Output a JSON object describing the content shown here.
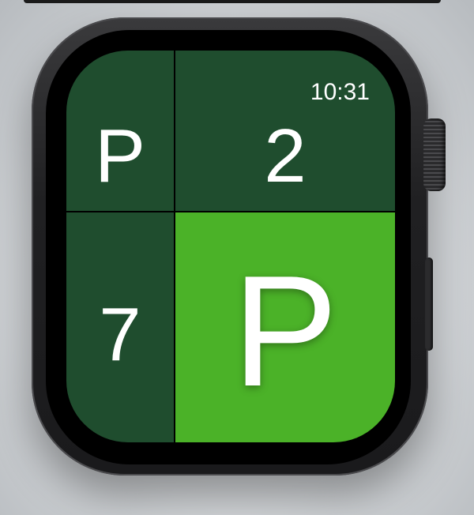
{
  "status": {
    "time": "10:31"
  },
  "board": {
    "top_left": "P",
    "top_right": "2",
    "bottom_left": "7",
    "bottom_right": "P"
  },
  "colors": {
    "cell_dark": "#1f4d2e",
    "cell_active": "#4bb228",
    "grid_line": "#000000",
    "text": "#ffffff"
  }
}
